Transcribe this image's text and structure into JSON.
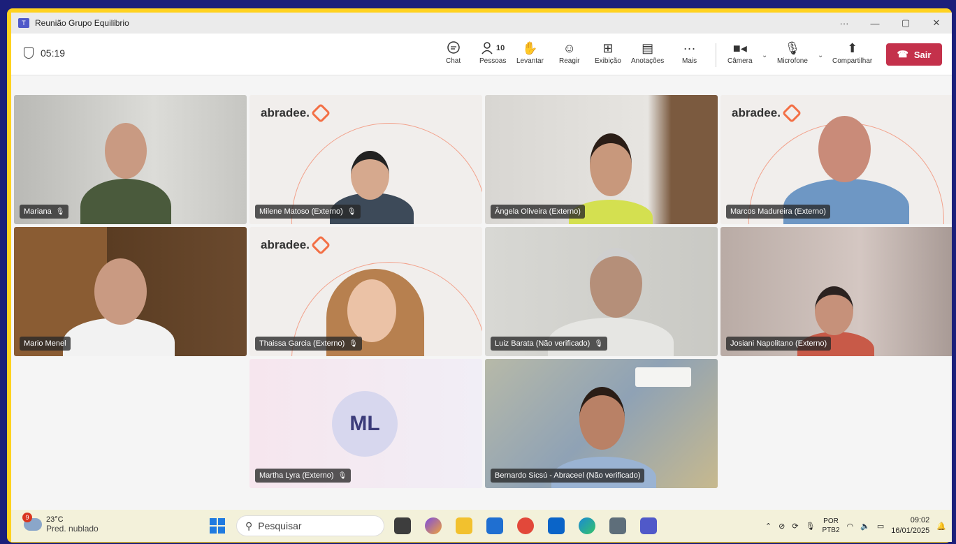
{
  "window": {
    "title": "Reunião Grupo Equilíbrio",
    "controls": {
      "more": "···",
      "minimize": "—",
      "restore": "▢",
      "close": "✕"
    }
  },
  "meeting": {
    "timer": "05:19",
    "toolbar": {
      "chat": "Chat",
      "people": "Pessoas",
      "people_count": "10",
      "raise": "Levantar",
      "react": "Reagir",
      "view": "Exibição",
      "notes": "Anotações",
      "more": "Mais",
      "camera": "Câmera",
      "mic": "Microfone",
      "share": "Compartilhar",
      "leave": "Sair"
    }
  },
  "participants": [
    {
      "name": "Mariana",
      "muted": true
    },
    {
      "name": "Milene Matoso (Externo)",
      "muted": true,
      "logo": "abradee"
    },
    {
      "name": "Ângela Oliveira (Externo)",
      "muted": false
    },
    {
      "name": "Marcos Madureira (Externo)",
      "muted": false,
      "logo": "abradee"
    },
    {
      "name": "Mario Menel",
      "muted": false
    },
    {
      "name": "Thaissa Garcia (Externo)",
      "muted": true,
      "logo": "abradee"
    },
    {
      "name": "Luiz Barata (Não verificado)",
      "muted": true
    },
    {
      "name": "Josiani Napolitano (Externo)",
      "muted": false
    },
    {
      "name": "Martha Lyra (Externo)",
      "muted": true,
      "initials": "ML"
    },
    {
      "name": "Bernardo Sicsú - Abraceel (Não verificado)",
      "muted": false
    }
  ],
  "abradee_logo_text": "abradee.",
  "taskbar": {
    "weather_temp": "23°C",
    "weather_desc": "Pred. nublado",
    "weather_badge": "9",
    "search_placeholder": "Pesquisar",
    "lang_top": "POR",
    "lang_bottom": "PTB2",
    "time": "09:02",
    "date": "16/01/2025"
  }
}
